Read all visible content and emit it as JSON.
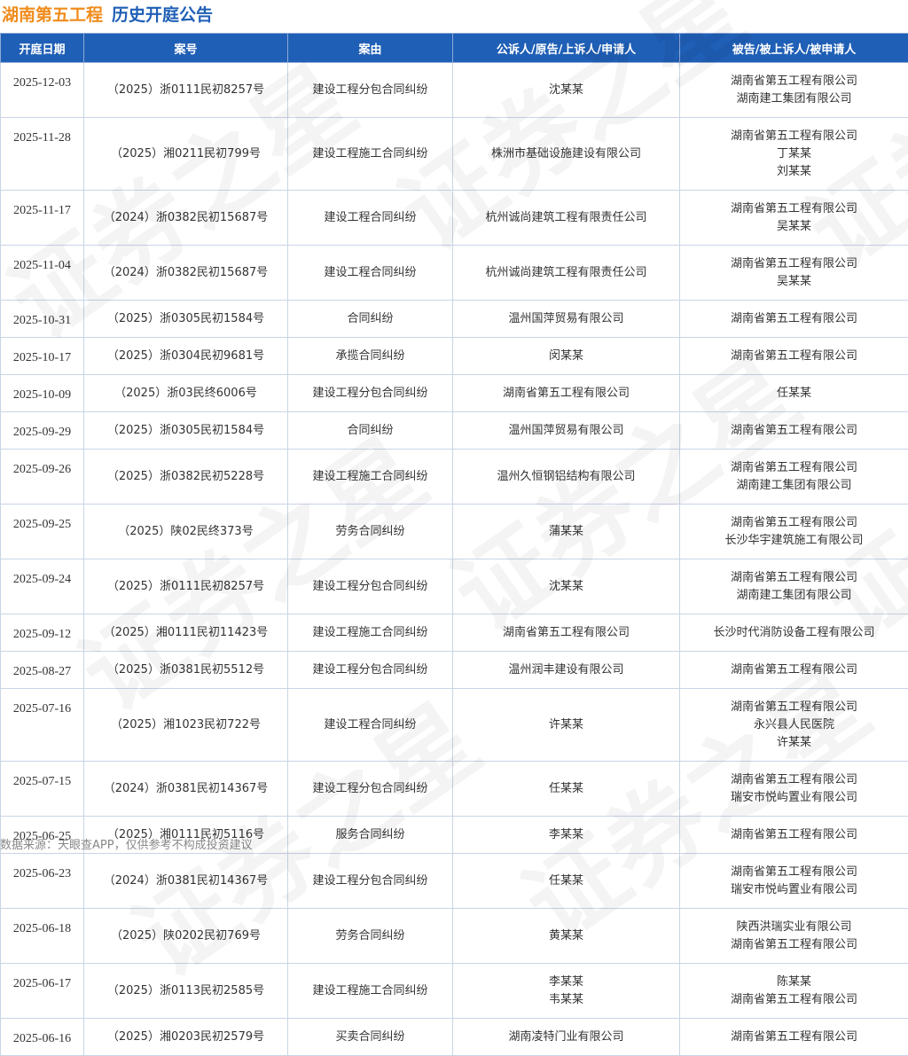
{
  "header": {
    "company": "湖南第五工程",
    "section": "历史开庭公告"
  },
  "table": {
    "columns": [
      "开庭日期",
      "案号",
      "案由",
      "公诉人/原告/上诉人/申请人",
      "被告/被上诉人/被申请人"
    ],
    "rows": [
      {
        "date": "2025-12-03",
        "case_no": "（2025）浙0111民初8257号",
        "cause": "建设工程分包合同纠纷",
        "plaintiff": [
          "沈某某"
        ],
        "defendant": [
          "湖南省第五工程有限公司",
          "湖南建工集团有限公司"
        ]
      },
      {
        "date": "2025-11-28",
        "case_no": "（2025）湘0211民初799号",
        "cause": "建设工程施工合同纠纷",
        "plaintiff": [
          "株洲市基础设施建设有限公司"
        ],
        "defendant": [
          "湖南省第五工程有限公司",
          "丁某某",
          "刘某某"
        ]
      },
      {
        "date": "2025-11-17",
        "case_no": "（2024）浙0382民初15687号",
        "cause": "建设工程合同纠纷",
        "plaintiff": [
          "杭州诚尚建筑工程有限责任公司"
        ],
        "defendant": [
          "湖南省第五工程有限公司",
          "吴某某"
        ]
      },
      {
        "date": "2025-11-04",
        "case_no": "（2024）浙0382民初15687号",
        "cause": "建设工程合同纠纷",
        "plaintiff": [
          "杭州诚尚建筑工程有限责任公司"
        ],
        "defendant": [
          "湖南省第五工程有限公司",
          "吴某某"
        ]
      },
      {
        "date": "2025-10-31",
        "case_no": "（2025）浙0305民初1584号",
        "cause": "合同纠纷",
        "plaintiff": [
          "温州国萍贸易有限公司"
        ],
        "defendant": [
          "湖南省第五工程有限公司"
        ]
      },
      {
        "date": "2025-10-17",
        "case_no": "（2025）浙0304民初9681号",
        "cause": "承揽合同纠纷",
        "plaintiff": [
          "闵某某"
        ],
        "defendant": [
          "湖南省第五工程有限公司"
        ]
      },
      {
        "date": "2025-10-09",
        "case_no": "（2025）浙03民终6006号",
        "cause": "建设工程分包合同纠纷",
        "plaintiff": [
          "湖南省第五工程有限公司"
        ],
        "defendant": [
          "任某某"
        ]
      },
      {
        "date": "2025-09-29",
        "case_no": "（2025）浙0305民初1584号",
        "cause": "合同纠纷",
        "plaintiff": [
          "温州国萍贸易有限公司"
        ],
        "defendant": [
          "湖南省第五工程有限公司"
        ]
      },
      {
        "date": "2025-09-26",
        "case_no": "（2025）浙0382民初5228号",
        "cause": "建设工程施工合同纠纷",
        "plaintiff": [
          "温州久恒钢铝结构有限公司"
        ],
        "defendant": [
          "湖南省第五工程有限公司",
          "湖南建工集团有限公司"
        ]
      },
      {
        "date": "2025-09-25",
        "case_no": "（2025）陕02民终373号",
        "cause": "劳务合同纠纷",
        "plaintiff": [
          "蒲某某"
        ],
        "defendant": [
          "湖南省第五工程有限公司",
          "长沙华宇建筑施工有限公司"
        ]
      },
      {
        "date": "2025-09-24",
        "case_no": "（2025）浙0111民初8257号",
        "cause": "建设工程分包合同纠纷",
        "plaintiff": [
          "沈某某"
        ],
        "defendant": [
          "湖南省第五工程有限公司",
          "湖南建工集团有限公司"
        ]
      },
      {
        "date": "2025-09-12",
        "case_no": "（2025）湘0111民初11423号",
        "cause": "建设工程施工合同纠纷",
        "plaintiff": [
          "湖南省第五工程有限公司"
        ],
        "defendant": [
          "长沙时代消防设备工程有限公司"
        ]
      },
      {
        "date": "2025-08-27",
        "case_no": "（2025）浙0381民初5512号",
        "cause": "建设工程分包合同纠纷",
        "plaintiff": [
          "温州润丰建设有限公司"
        ],
        "defendant": [
          "湖南省第五工程有限公司"
        ]
      },
      {
        "date": "2025-07-16",
        "case_no": "（2025）湘1023民初722号",
        "cause": "建设工程合同纠纷",
        "plaintiff": [
          "许某某"
        ],
        "defendant": [
          "湖南省第五工程有限公司",
          "永兴县人民医院",
          "许某某"
        ]
      },
      {
        "date": "2025-07-15",
        "case_no": "（2024）浙0381民初14367号",
        "cause": "建设工程分包合同纠纷",
        "plaintiff": [
          "任某某"
        ],
        "defendant": [
          "湖南省第五工程有限公司",
          "瑞安市悦屿置业有限公司"
        ]
      },
      {
        "date": "2025-06-25",
        "case_no": "（2025）湘0111民初5116号",
        "cause": "服务合同纠纷",
        "plaintiff": [
          "李某某"
        ],
        "defendant": [
          "湖南省第五工程有限公司"
        ]
      },
      {
        "date": "2025-06-23",
        "case_no": "（2024）浙0381民初14367号",
        "cause": "建设工程分包合同纠纷",
        "plaintiff": [
          "任某某"
        ],
        "defendant": [
          "湖南省第五工程有限公司",
          "瑞安市悦屿置业有限公司"
        ]
      },
      {
        "date": "2025-06-18",
        "case_no": "（2025）陕0202民初769号",
        "cause": "劳务合同纠纷",
        "plaintiff": [
          "黄某某"
        ],
        "defendant": [
          "陕西洪瑞实业有限公司",
          "湖南省第五工程有限公司"
        ]
      },
      {
        "date": "2025-06-17",
        "case_no": "（2025）浙0113民初2585号",
        "cause": "建设工程施工合同纠纷",
        "plaintiff": [
          "李某某",
          "韦某某"
        ],
        "defendant": [
          "陈某某",
          "湖南省第五工程有限公司"
        ]
      },
      {
        "date": "2025-06-16",
        "case_no": "（2025）湘0203民初2579号",
        "cause": "买卖合同纠纷",
        "plaintiff": [
          "湖南凌特门业有限公司"
        ],
        "defendant": [
          "湖南省第五工程有限公司"
        ]
      }
    ]
  },
  "footer": {
    "source": "数据来源：天眼查APP，仅供参考不构成投资建议"
  },
  "watermark": {
    "text": "证券之星"
  },
  "colors": {
    "header_bg": "#1f5fb6",
    "company": "#f08c1c",
    "section": "#1f5fb6",
    "border": "#c9d4e6"
  }
}
